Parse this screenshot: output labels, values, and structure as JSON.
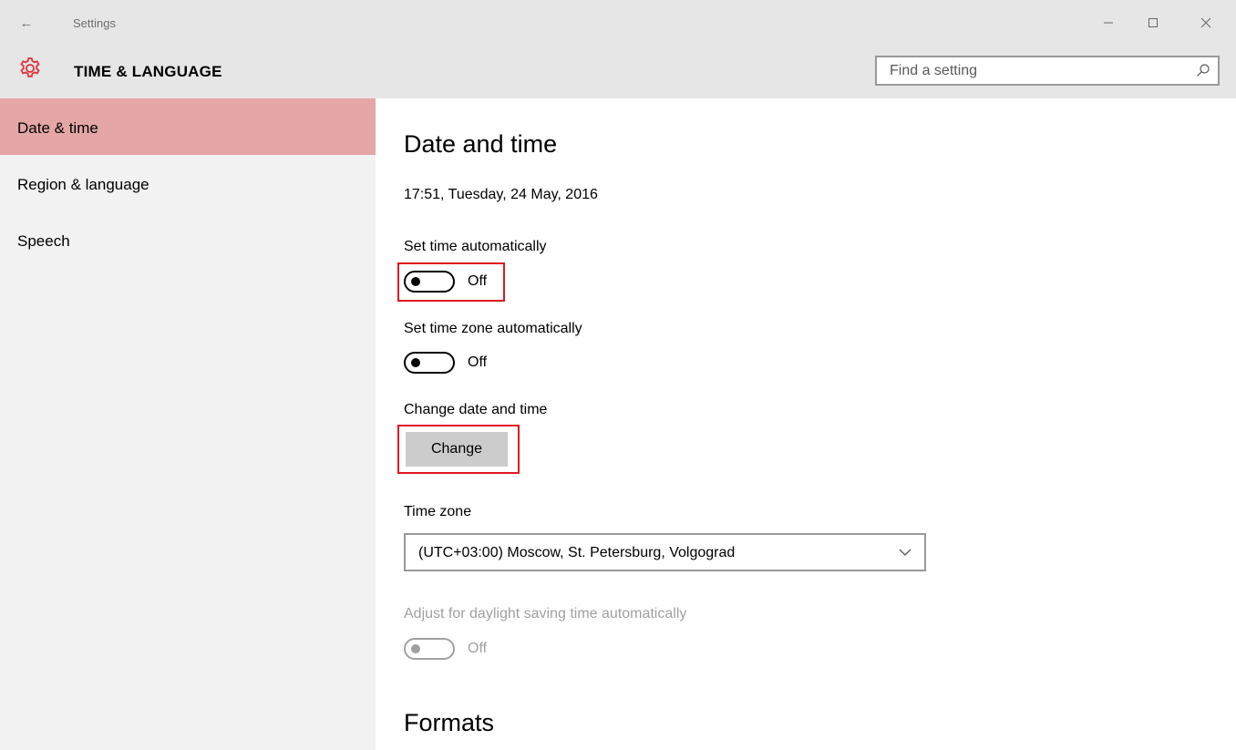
{
  "window": {
    "app_title": "Settings",
    "back_glyph": "←",
    "controls": [
      "minimize-icon",
      "maximize-icon",
      "close-icon"
    ]
  },
  "header": {
    "section_title": "TIME & LANGUAGE",
    "icon": "gear-icon",
    "search_placeholder": "Find a setting"
  },
  "sidebar": {
    "items": [
      {
        "label": "Date & time",
        "selected": true
      },
      {
        "label": "Region & language",
        "selected": false
      },
      {
        "label": "Speech",
        "selected": false
      }
    ]
  },
  "main": {
    "heading": "Date and time",
    "current_datetime": "17:51, Tuesday, 24 May, 2016",
    "set_time_auto": {
      "label": "Set time automatically",
      "state": "Off"
    },
    "set_timezone_auto": {
      "label": "Set time zone automatically",
      "state": "Off"
    },
    "change_datetime": {
      "label": "Change date and time",
      "button": "Change"
    },
    "time_zone": {
      "label": "Time zone",
      "value": "(UTC+03:00) Moscow, St. Petersburg, Volgograd"
    },
    "daylight_saving": {
      "label": "Adjust for daylight saving time automatically",
      "state": "Off",
      "disabled": true
    },
    "formats_heading": "Formats"
  },
  "colors": {
    "accent_selected": "#e4a6a6",
    "gear_red": "#e0313a",
    "highlight_red": "#e0181e",
    "titlebar_bg": "#e6e6e6",
    "sidebar_bg": "#f2f2f2"
  }
}
